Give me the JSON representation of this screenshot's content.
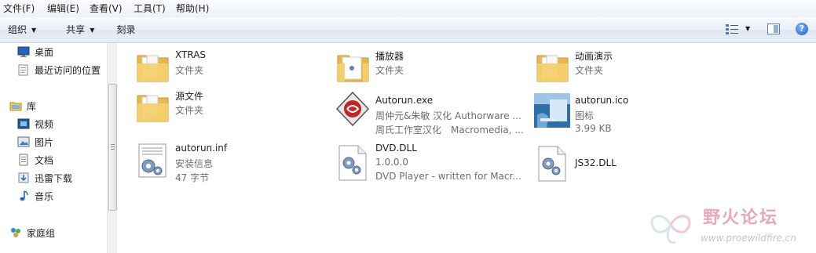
{
  "menubar": {
    "items": [
      "文件(F)",
      "编辑(E)",
      "查看(V)",
      "工具(T)",
      "帮助(H)"
    ]
  },
  "toolbar": {
    "organize": "组织",
    "share": "共享",
    "burn": "刻录",
    "help": "?"
  },
  "nav": {
    "desktop": "桌面",
    "recent": "最近访问的位置",
    "library": "库",
    "videos": "视频",
    "pictures": "图片",
    "documents": "文档",
    "thunder": "迅雷下载",
    "music": "音乐",
    "homegroup": "家庭组"
  },
  "files": [
    {
      "name": "XTRAS",
      "line1": "文件夹",
      "line2": "",
      "icon": "folder-icon"
    },
    {
      "name": "播放器",
      "line1": "文件夹",
      "line2": "",
      "icon": "folder-icon"
    },
    {
      "name": "动画演示",
      "line1": "文件夹",
      "line2": "",
      "icon": "folder-icon"
    },
    {
      "name": "源文件",
      "line1": "文件夹",
      "line2": "",
      "icon": "folder-icon"
    },
    {
      "name": "Autorun.exe",
      "line1": "周仲元&朱敏 汉化 Authorware ...",
      "line2": "周氏工作室汉化　Macromedia, ...",
      "icon": "authorware-icon"
    },
    {
      "name": "autorun.ico",
      "line1": "图标",
      "line2": "3.99 KB",
      "icon": "image-thumbnail-icon"
    },
    {
      "name": "autorun.inf",
      "line1": "安装信息",
      "line2": "47 字节",
      "icon": "settings-file-icon"
    },
    {
      "name": "DVD.DLL",
      "line1": "1.0.0.0",
      "line2": "DVD Player - written for Macr...",
      "icon": "dll-file-icon"
    },
    {
      "name": "JS32.DLL",
      "line1": "",
      "line2": "",
      "icon": "dll-file-icon"
    }
  ],
  "watermark": {
    "title": "野火论坛",
    "url": "www.proewildfire.cn"
  },
  "colors": {
    "folder": "#f3cf6b",
    "toolbar_bg": "#e9eff7",
    "secondary_text": "#6d6d6d"
  }
}
